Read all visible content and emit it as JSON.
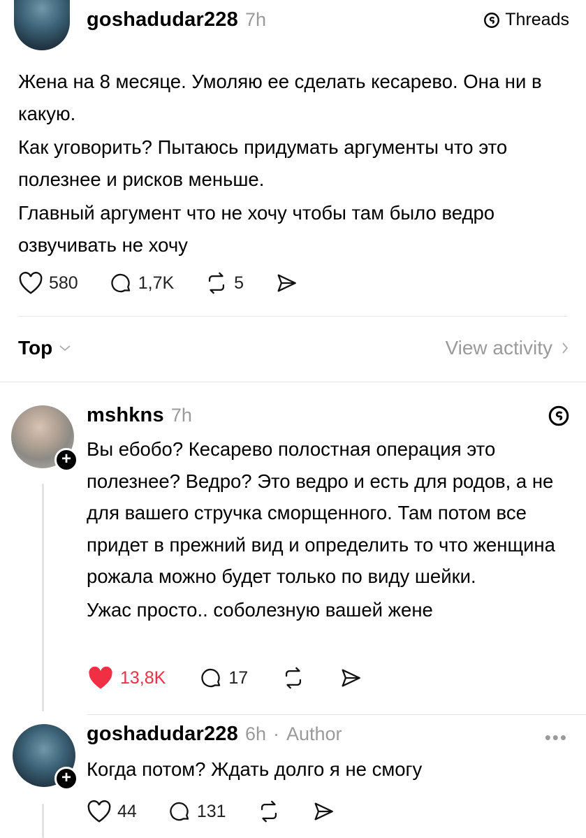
{
  "post": {
    "username": "goshadudar228",
    "time": "7h",
    "brand": "Threads",
    "paragraphs": [
      "Жена на 8 месяце. Умоляю ее сделать кесарево. Она ни в какую.",
      "Как уговорить? Пытаюсь придумать аргументы что это полезнее и рисков меньше.",
      "Главный аргумент что не хочу чтобы там было ведро озвучивать не хочу"
    ],
    "likes": "580",
    "replies": "1,7K",
    "reposts": "5"
  },
  "sort": {
    "label": "Top",
    "view_activity": "View activity"
  },
  "comments": [
    {
      "username": "mshkns",
      "time": "7h",
      "author_tag": "",
      "paragraphs": [
        "Вы ебобо? Кесарево полостная операция это полезнее? Ведро? Это ведро и есть для родов, а не для вашего стручка сморщенного. Там потом все придет в прежний вид и определить то что женщина рожала можно будет только по виду шейки.",
        "Ужас просто.. соболезную вашей жене"
      ],
      "likes": "13,8K",
      "replies": "17",
      "liked": true
    },
    {
      "username": "goshadudar228",
      "time": "6h",
      "author_tag": "Author",
      "paragraphs": [
        "Когда потом? Ждать долго я не смогу"
      ],
      "likes": "44",
      "replies": "131",
      "liked": false
    }
  ],
  "colors": {
    "accent_like": "#f02f45",
    "muted": "#9a9a9a",
    "divider": "#e6e6e6"
  }
}
